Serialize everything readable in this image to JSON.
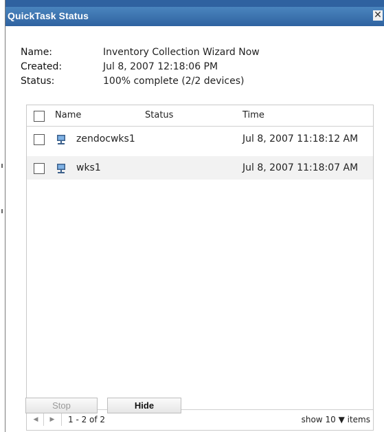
{
  "dialog": {
    "title": "QuickTask Status",
    "close_glyph": "✕",
    "close_icon": "close-icon"
  },
  "info": {
    "name_label": "Name:",
    "name_value": "Inventory Collection Wizard Now",
    "created_label": "Created:",
    "created_value": "Jul 8, 2007 12:18:06 PM",
    "status_label": "Status:",
    "status_value": "100% complete (2/2 devices)"
  },
  "grid": {
    "columns": {
      "name": "Name",
      "status": "Status",
      "time": "Time"
    },
    "rows": [
      {
        "name": "zendocwks1",
        "status": "",
        "time": "Jul 8, 2007 11:18:12 AM",
        "icon": "workstation-icon"
      },
      {
        "name": "wks1",
        "status": "",
        "time": "Jul 8, 2007 11:18:07 AM",
        "icon": "workstation-icon"
      }
    ],
    "footer": {
      "range": "1 - 2 of 2",
      "show_label": "show",
      "page_size": "10",
      "items_label": "items"
    }
  },
  "buttons": {
    "stop": "Stop",
    "hide": "Hide"
  },
  "colors": {
    "titlebar": "#2f62a0",
    "row_alt": "#f2f2f2",
    "text": "#222222"
  }
}
